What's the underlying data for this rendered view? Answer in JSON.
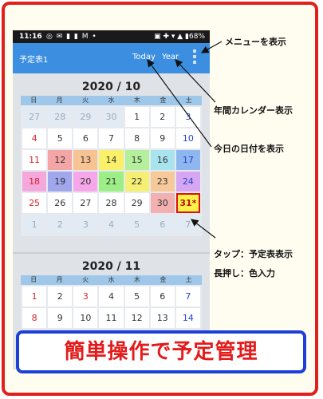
{
  "statusbar": {
    "time": "11:16",
    "icons": "◎ ✉ ▮ ▮ M •",
    "right": "▣ ✚ ▾ ▲ ▮68%"
  },
  "appbar": {
    "title": "予定表1",
    "today": "Today",
    "year": "Year"
  },
  "oct": {
    "title": "2020 / 10",
    "dow": [
      "日",
      "月",
      "火",
      "水",
      "木",
      "金",
      "土"
    ],
    "weeks": [
      [
        {
          "d": "27",
          "o": 1
        },
        {
          "d": "28",
          "o": 1
        },
        {
          "d": "29",
          "o": 1
        },
        {
          "d": "30",
          "o": 1
        },
        {
          "d": "1"
        },
        {
          "d": "2"
        },
        {
          "d": "3"
        }
      ],
      [
        {
          "d": "4"
        },
        {
          "d": "5"
        },
        {
          "d": "6"
        },
        {
          "d": "7"
        },
        {
          "d": "8"
        },
        {
          "d": "9"
        },
        {
          "d": "10"
        }
      ],
      [
        {
          "d": "11"
        },
        {
          "d": "12",
          "bg": "#f4a5a5"
        },
        {
          "d": "13",
          "bg": "#f7c393"
        },
        {
          "d": "14",
          "bg": "#fbf06a"
        },
        {
          "d": "15",
          "bg": "#b4ef9b"
        },
        {
          "d": "16",
          "bg": "#a8e3ee"
        },
        {
          "d": "17",
          "bg": "#8fb7ef"
        }
      ],
      [
        {
          "d": "18",
          "bg": "#f5a8dc"
        },
        {
          "d": "19",
          "bg": "#a0a7ec"
        },
        {
          "d": "20",
          "bg": "#f6a7ea"
        },
        {
          "d": "21",
          "bg": "#9cef86"
        },
        {
          "d": "22",
          "bg": "#f5ef74"
        },
        {
          "d": "23",
          "bg": "#f6c999"
        },
        {
          "d": "24",
          "bg": "#d7a6f2"
        }
      ],
      [
        {
          "d": "25"
        },
        {
          "d": "26"
        },
        {
          "d": "27"
        },
        {
          "d": "28"
        },
        {
          "d": "29"
        },
        {
          "d": "30",
          "bg": "#f2b0b0"
        },
        {
          "d": "31*",
          "bg": "#fcf24a",
          "sel": 1
        }
      ],
      [
        {
          "d": "1",
          "o": 1
        },
        {
          "d": "2",
          "o": 1
        },
        {
          "d": "3",
          "o": 1
        },
        {
          "d": "4",
          "o": 1
        },
        {
          "d": "5",
          "o": 1
        },
        {
          "d": "6",
          "o": 1
        },
        {
          "d": "7",
          "o": 1
        }
      ]
    ]
  },
  "nov": {
    "title": "2020 / 11",
    "dow": [
      "日",
      "月",
      "火",
      "水",
      "木",
      "金",
      "土"
    ],
    "weeks": [
      [
        {
          "d": "1"
        },
        {
          "d": "2"
        },
        {
          "d": "3",
          "red": 1
        },
        {
          "d": "4"
        },
        {
          "d": "5"
        },
        {
          "d": "6"
        },
        {
          "d": "7"
        }
      ],
      [
        {
          "d": "8"
        },
        {
          "d": "9"
        },
        {
          "d": "10"
        },
        {
          "d": "11"
        },
        {
          "d": "12"
        },
        {
          "d": "13"
        },
        {
          "d": "14"
        }
      ]
    ]
  },
  "callouts": {
    "menu": "メニューを表示",
    "year": "年間カレンダー表示",
    "today": "今日の日付を表示",
    "tap": "タップ：予定表表示",
    "longpress": "長押し：色入力"
  },
  "banner": "簡単操作で予定管理"
}
